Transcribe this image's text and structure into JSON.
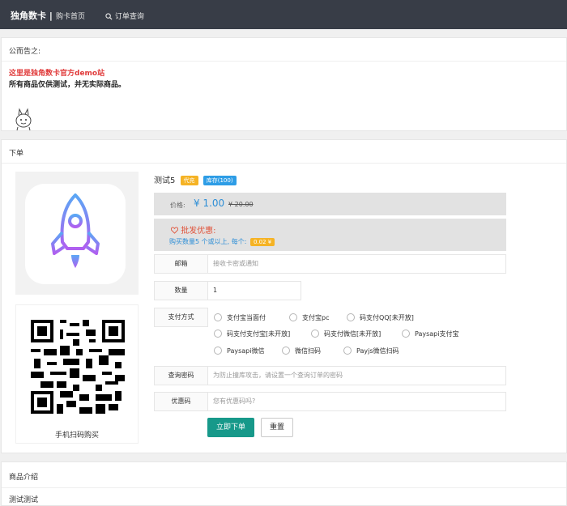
{
  "header": {
    "brand": "独角数卡 |",
    "nav_home": "购卡首页",
    "nav_query": "订单查询"
  },
  "notice": {
    "title": "公而告之:",
    "line_red": "这里是独角数卡官方demo站",
    "line_black": "所有商品仅供测试，并无实际商品。"
  },
  "order": {
    "title": "下单",
    "product": {
      "name": "测试5",
      "badge_auto": "代充",
      "badge_stock": "库存(100)",
      "price_label": "价格:",
      "price_now": "¥ 1.00",
      "price_old": "¥ 20.00",
      "bulk_title": "批发优惠:",
      "bulk_text": "购买数量5 个或以上, 每个:",
      "bulk_amount": "0.02 ¥",
      "qr_label": "手机扫码购买"
    },
    "form": {
      "email_label": "邮箱",
      "email_placeholder": "接收卡密或通知",
      "qty_label": "数量",
      "qty_value": "1",
      "pay_label": "支付方式",
      "pay_options": [
        "支付宝当面付",
        "支付宝pc",
        "码支付QQ[未开放]",
        "码支付支付宝[未开放]",
        "码支付微信[未开放]",
        "Paysapi支付宝",
        "Paysapi微信",
        "微信扫码",
        "Payjs微信扫码"
      ],
      "pwd_label": "查询密码",
      "pwd_placeholder": "为防止撞库攻击，请设置一个查询订单的密码",
      "coupon_label": "优惠码",
      "coupon_placeholder": "您有优惠码吗?",
      "submit_label": "立即下单",
      "reset_label": "重置"
    }
  },
  "intro": {
    "title": "商品介绍",
    "body": "测试测试"
  },
  "colors": {
    "topbar": "#383d47",
    "accent_green": "#17998a",
    "price_blue": "#2d8ed6",
    "badge_orange": "#f5b325",
    "badge_blue": "#2e9de6",
    "notice_red": "#e03a3a"
  }
}
